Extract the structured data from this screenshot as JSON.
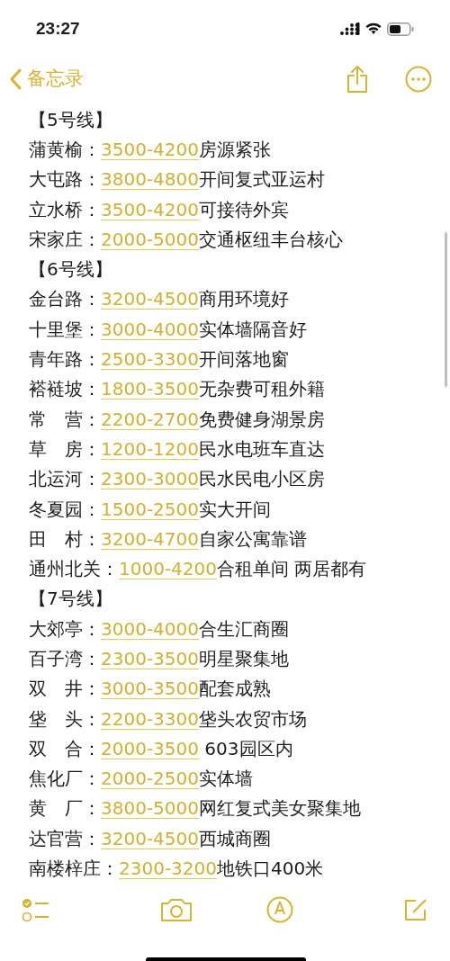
{
  "status_bar": {
    "time": "23:27"
  },
  "nav": {
    "back_label": "备忘录"
  },
  "lines": [
    {
      "kind": "header",
      "text": "【5号线】"
    },
    {
      "kind": "entry",
      "station": "蒲黄榆：",
      "price": "3500-4200",
      "note": "房源紧张"
    },
    {
      "kind": "entry",
      "station": "大屯路：",
      "price": "3800-4800",
      "note": "开间复式亚运村"
    },
    {
      "kind": "entry",
      "station": "立水桥：",
      "price": "3500-4200",
      "note": "可接待外宾"
    },
    {
      "kind": "entry",
      "station": "宋家庄：",
      "price": "2000-5000",
      "note": "交通枢纽丰台核心"
    },
    {
      "kind": "header",
      "text": "【6号线】"
    },
    {
      "kind": "entry",
      "station": "金台路：",
      "price": "3200-4500",
      "note": "商用环境好"
    },
    {
      "kind": "entry",
      "station": "十里堡：",
      "price": "3000-4000",
      "note": "实体墙隔音好"
    },
    {
      "kind": "entry",
      "station": "青年路：",
      "price": "2500-3300",
      "note": "开间落地窗"
    },
    {
      "kind": "entry",
      "station": "褡裢坡：",
      "price": "1800-3500",
      "note": "无杂费可租外籍"
    },
    {
      "kind": "entry",
      "station": "常　营：",
      "price": "2200-2700",
      "note": "免费健身湖景房"
    },
    {
      "kind": "entry",
      "station": "草　房：",
      "price": "1200-1200",
      "note": "民水电班车直达"
    },
    {
      "kind": "entry",
      "station": "北运河：",
      "price": "2300-3000",
      "note": "民水民电小区房"
    },
    {
      "kind": "entry",
      "station": "冬夏园：",
      "price": "1500-2500",
      "note": "实大开间"
    },
    {
      "kind": "entry",
      "station": "田　村：",
      "price": "3200-4700",
      "note": "自家公寓靠谱"
    },
    {
      "kind": "entry",
      "station": "通州北关：",
      "price": "1000-4200",
      "note": "合租单间 两居都有"
    },
    {
      "kind": "header",
      "text": "【7号线】"
    },
    {
      "kind": "entry",
      "station": "大郊亭：",
      "price": "3000-4000",
      "note": "合生汇商圈"
    },
    {
      "kind": "entry",
      "station": "百子湾：",
      "price": "2300-3500",
      "note": "明星聚集地"
    },
    {
      "kind": "entry",
      "station": "双　井：",
      "price": "3000-3500",
      "note": "配套成熟"
    },
    {
      "kind": "entry",
      "station": "垡　头：",
      "price": "2200-3300",
      "note": "垡头农贸市场"
    },
    {
      "kind": "entry",
      "station": "双　合：",
      "price": "2000-3500",
      "note": " 603园区内"
    },
    {
      "kind": "entry",
      "station": "焦化厂：",
      "price": "2000-2500",
      "note": "实体墙"
    },
    {
      "kind": "entry",
      "station": "黄　厂：",
      "price": "3800-5000",
      "note": "网红复式美女聚集地"
    },
    {
      "kind": "entry",
      "station": "达官营：",
      "price": "3200-4500",
      "note": "西城商圈"
    },
    {
      "kind": "entry",
      "station": "南楼梓庄：",
      "price": "2300-3200",
      "note": "地铁口400米"
    }
  ]
}
